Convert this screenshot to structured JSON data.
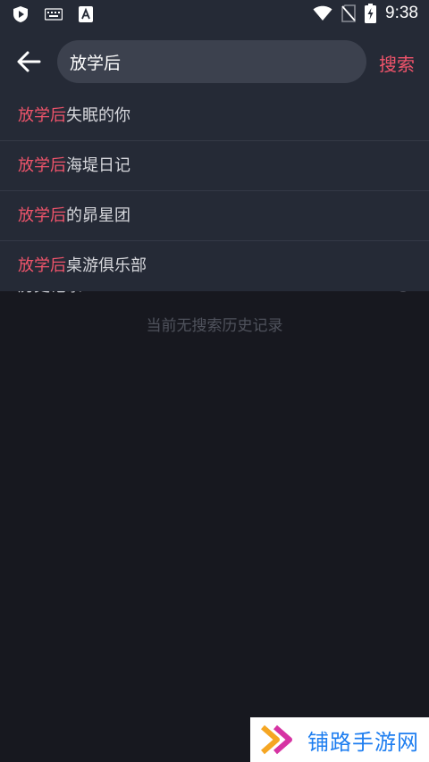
{
  "status_bar": {
    "time": "9:38",
    "icons": [
      "play-shield-icon",
      "keyboard-icon",
      "font-a-icon",
      "wifi-icon",
      "no-sim-icon",
      "battery-charging-icon"
    ]
  },
  "header": {
    "back_icon": "arrow-left-icon",
    "search_value": "放学后",
    "search_button": "搜索"
  },
  "suggestions": [
    {
      "highlight": "放学后",
      "rest": "失眠的你"
    },
    {
      "highlight": "放学后",
      "rest": "海堤日记"
    },
    {
      "highlight": "放学后",
      "rest": "的昴星团"
    },
    {
      "highlight": "放学后",
      "rest": "桌游俱乐部"
    }
  ],
  "history": {
    "title": "历史记录",
    "empty_text": "当前无搜索历史记录"
  },
  "watermark": {
    "text": "铺路手游网"
  },
  "colors": {
    "accent": "#f1546b",
    "background": "#17181f",
    "panel": "#252a36",
    "search_box": "#3c414e",
    "watermark_blue": "#1e7ef0",
    "watermark_orange": "#f5a623"
  }
}
